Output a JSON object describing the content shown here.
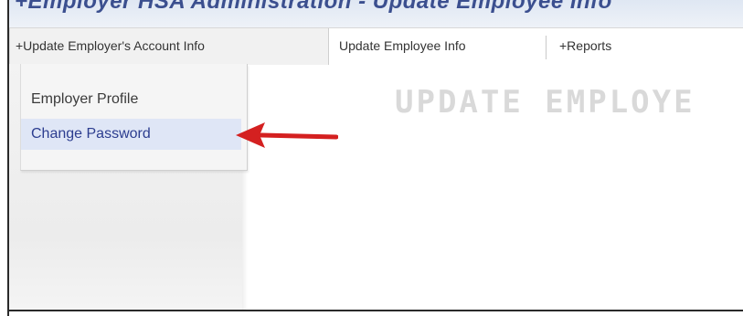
{
  "header": {
    "title": "+Employer HSA Administration - Update Employee Info"
  },
  "navbar": {
    "items": [
      {
        "label": "+Update Employer's Account Info"
      },
      {
        "label": "Update Employee Info"
      },
      {
        "label": "+Reports"
      }
    ]
  },
  "dropdown": {
    "items": [
      {
        "label": "Employer Profile"
      },
      {
        "label": "Change Password"
      }
    ]
  },
  "main": {
    "heading": "UPDATE EMPLOYE"
  },
  "colors": {
    "header_text": "#3b4f8f",
    "menu_highlight_bg": "#dfe6f6",
    "menu_highlight_text": "#2c3d8f",
    "arrow": "#d42020",
    "heading_text": "#d9d9d9"
  },
  "icons": {
    "annotation_arrow": "left-arrow-icon"
  }
}
